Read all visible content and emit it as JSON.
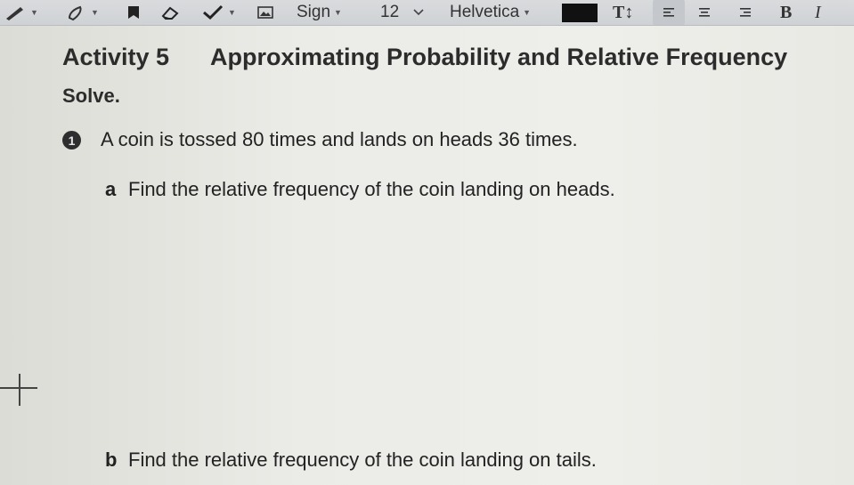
{
  "toolbar": {
    "sign_label": "Sign",
    "font_size": "12",
    "font_name": "Helvetica",
    "text_size_label": "T↕",
    "bold_label": "B",
    "italic_label": "I",
    "text_color": "#111111"
  },
  "document": {
    "activity_label": "Activity 5",
    "title": "Approximating Probability and Relative Frequency",
    "instruction": "Solve.",
    "question_number": "1",
    "question_text": "A coin is tossed 80 times and lands on heads 36 times.",
    "parts": [
      {
        "label": "a",
        "text": "Find the relative frequency of the coin landing on heads."
      },
      {
        "label": "b",
        "text": "Find the relative frequency of the coin landing on tails."
      }
    ]
  }
}
